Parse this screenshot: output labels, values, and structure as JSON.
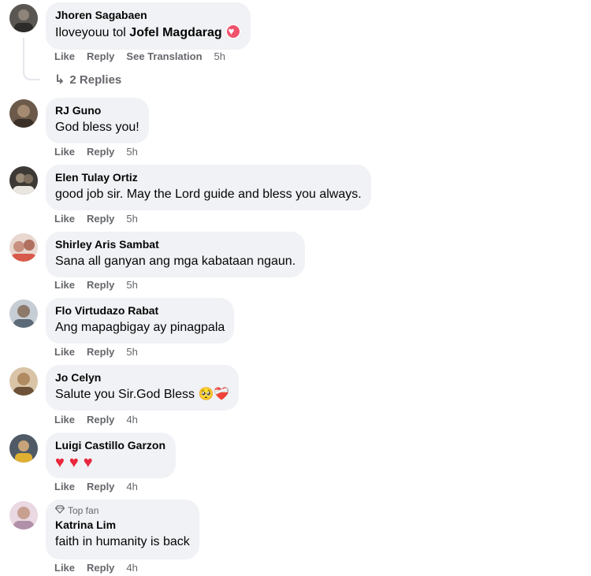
{
  "actions": {
    "like": "Like",
    "reply": "Reply",
    "see_translation": "See Translation"
  },
  "comments": [
    {
      "name": "Jhoren Sagabaen",
      "text": "Iloveyouu tol",
      "mention": "Jofel Magdarag",
      "reaction": "heart-icon",
      "time": "5h",
      "replies": "2 Replies",
      "avatar_color": "#5a5752"
    },
    {
      "name": "RJ Guno",
      "text": "God bless you!",
      "time": "5h",
      "avatar_color": "#6b5a4a"
    },
    {
      "name": "Elen Tulay Ortiz",
      "text": "good job sir. May the Lord guide and bless you always.",
      "time": "5h",
      "avatar_color": "#3d3a36"
    },
    {
      "name": "Shirley Aris Sambat",
      "text": "Sana all ganyan ang mga kabataan ngaun.",
      "time": "5h",
      "avatar_color": "#c89080"
    },
    {
      "name": "Flo Virtudazo Rabat",
      "text": "Ang mapagbigay ay pinagpala",
      "time": "5h",
      "avatar_color": "#9aa4ae"
    },
    {
      "name": "Jo Celyn",
      "text": "Salute you Sir.God Bless",
      "emoji": "🥺❤️‍🩹",
      "time": "4h",
      "avatar_color": "#b08a60"
    },
    {
      "name": "Luigi Castillo Garzon",
      "text": "❤️ ❤️ ❤️",
      "time": "4h",
      "avatar_color": "#4f5a66"
    },
    {
      "name": "Katrina Lim",
      "badge": "Top fan",
      "text": "faith in humanity is back",
      "time": "4h",
      "avatar_color": "#d8b8c8"
    }
  ]
}
